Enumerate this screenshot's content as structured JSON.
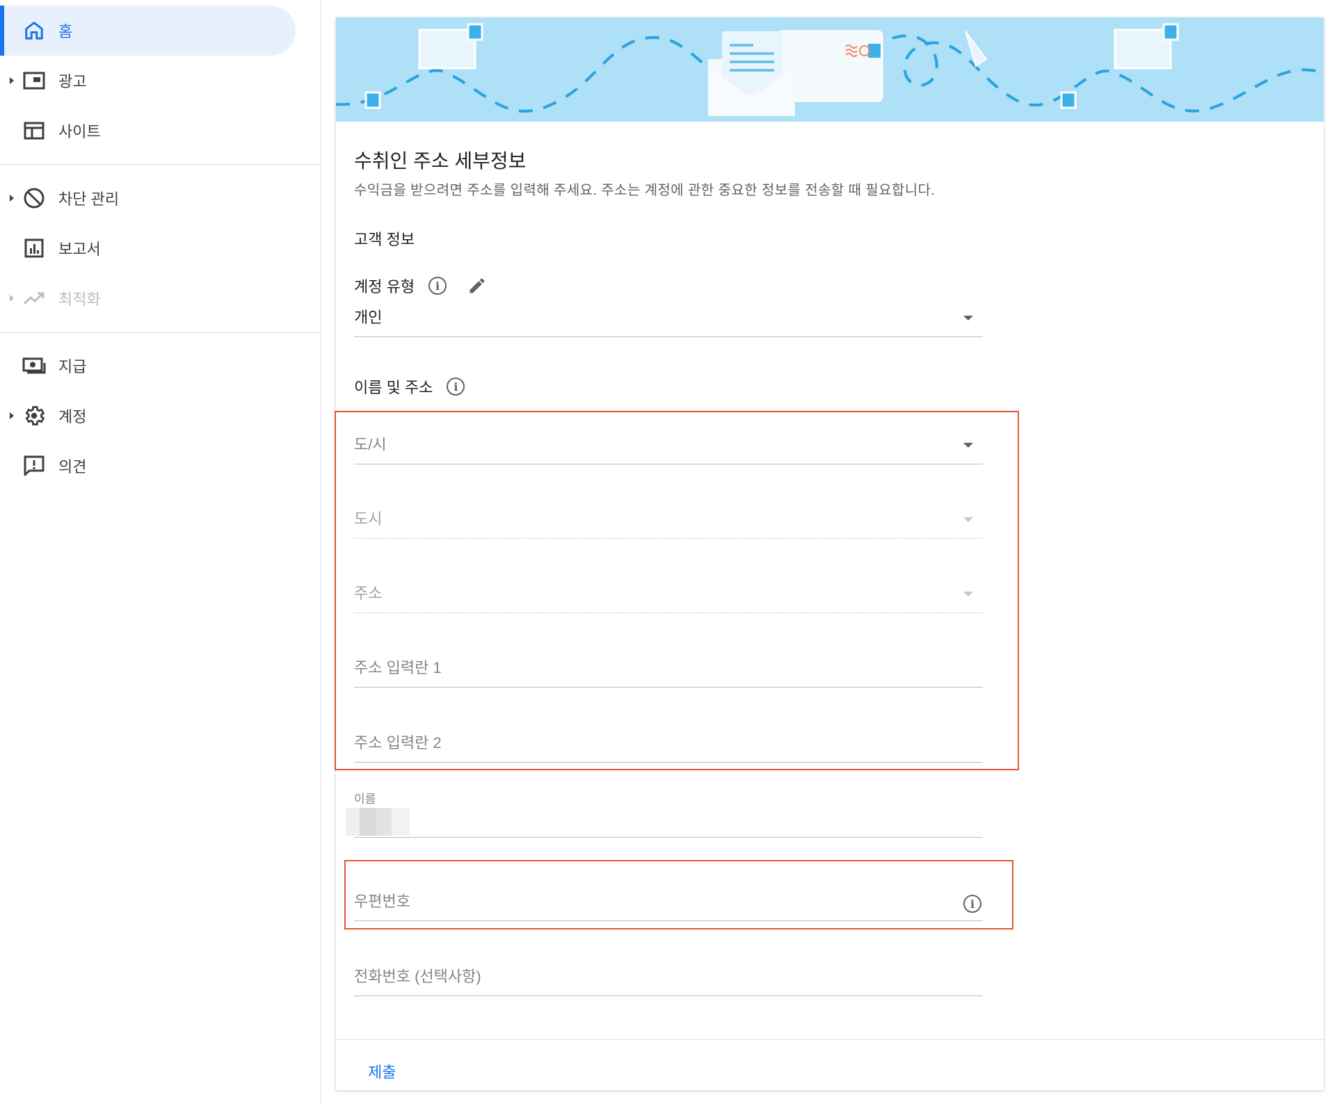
{
  "nav": {
    "items": [
      {
        "label": "홈"
      },
      {
        "label": "광고"
      },
      {
        "label": "사이트"
      },
      {
        "label": "차단 관리"
      },
      {
        "label": "보고서"
      },
      {
        "label": "최적화"
      },
      {
        "label": "지급"
      },
      {
        "label": "계정"
      },
      {
        "label": "의견"
      }
    ]
  },
  "form": {
    "title": "수취인 주소 세부정보",
    "description": "수익금을 받으려면 주소를 입력해 주세요. 주소는 계정에 관한 중요한 정보를 전송할 때 필요합니다.",
    "customer_section": "고객 정보",
    "account_type_label": "계정 유형",
    "account_type_value": "개인",
    "name_address_section": "이름 및 주소",
    "province_placeholder": "도/시",
    "city_placeholder": "도시",
    "address_placeholder": "주소",
    "address_line1_placeholder": "주소 입력란 1",
    "address_line2_placeholder": "주소 입력란 2",
    "name_label": "이름",
    "postal_code_placeholder": "우편번호",
    "phone_placeholder": "전화번호 (선택사항)",
    "submit_label": "제출"
  },
  "colors": {
    "accent": "#1a73e8",
    "highlight": "#e6542d",
    "banner": "#aee0f8"
  }
}
